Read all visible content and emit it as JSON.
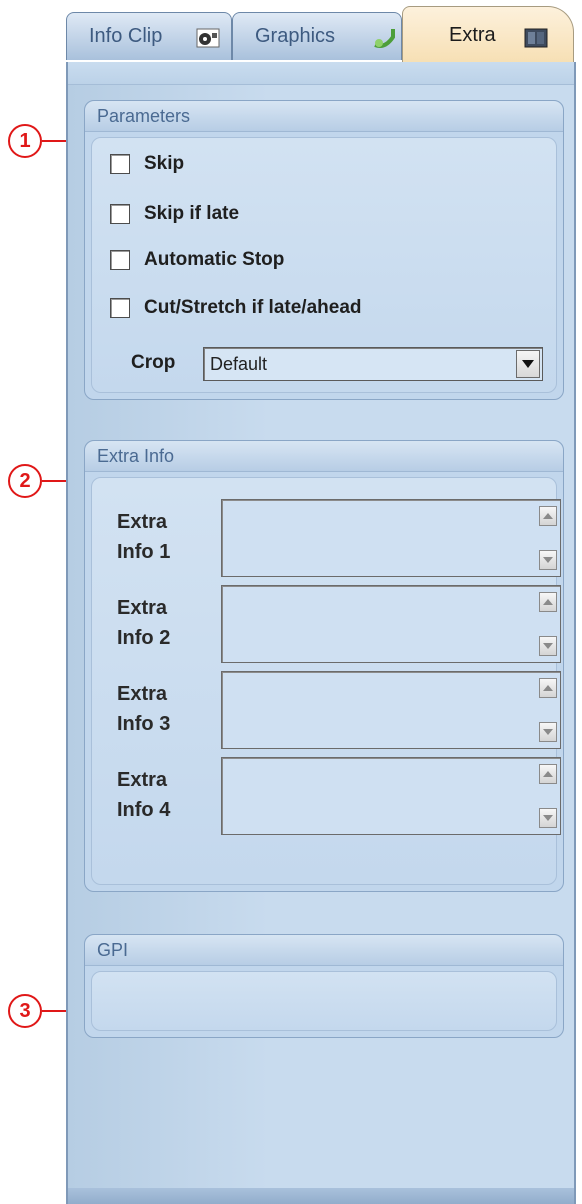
{
  "tabs": [
    {
      "label": "Info Clip",
      "icon": "film-reel-icon",
      "active": false
    },
    {
      "label": "Graphics",
      "icon": "graphics-icon",
      "active": false
    },
    {
      "label": "Extra",
      "icon": "extra-box-icon",
      "active": true
    }
  ],
  "parameters": {
    "title": "Parameters",
    "checkboxes": [
      {
        "label": "Skip",
        "checked": false
      },
      {
        "label": "Skip if late",
        "checked": false
      },
      {
        "label": "Automatic Stop",
        "checked": false
      },
      {
        "label": "Cut/Stretch if late/ahead",
        "checked": false
      }
    ],
    "crop_label": "Crop",
    "crop_value": "Default"
  },
  "extra_info": {
    "title": "Extra Info",
    "fields": [
      {
        "label_line1": "Extra",
        "label_line2": "Info 1",
        "value": ""
      },
      {
        "label_line1": "Extra",
        "label_line2": "Info 2",
        "value": ""
      },
      {
        "label_line1": "Extra",
        "label_line2": "Info 3",
        "value": ""
      },
      {
        "label_line1": "Extra",
        "label_line2": "Info 4",
        "value": ""
      }
    ]
  },
  "gpi": {
    "title": "GPI"
  },
  "callouts": [
    "1",
    "2",
    "3"
  ],
  "colors": {
    "callout": "#e01818",
    "panel": "#c8dbee",
    "active_tab": "#f6dfb3"
  }
}
